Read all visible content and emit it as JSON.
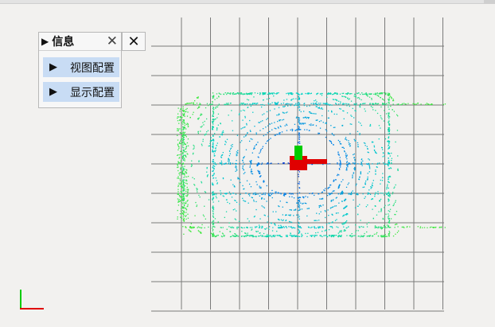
{
  "panel": {
    "title": "信息",
    "title_icon": "play-triangle-icon",
    "close_icon": "close-icon",
    "items": [
      {
        "label": "视图配置",
        "icon": "expand-triangle-icon"
      },
      {
        "label": "显示配置",
        "icon": "expand-triangle-icon"
      }
    ]
  },
  "window": {
    "close_icon": "close-icon"
  },
  "colors": {
    "grid": "#7a7a7a",
    "axis_x": "#ff0000",
    "axis_y": "#00cc00",
    "panel_item_bg": "#c8dcf4",
    "cloud_near": "#1020c8",
    "cloud_far": "#40e840"
  }
}
